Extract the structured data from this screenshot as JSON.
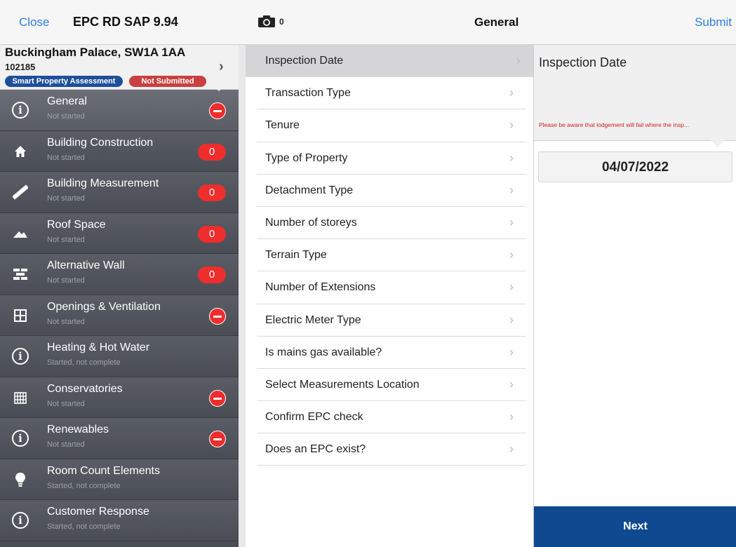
{
  "topbar": {
    "close_label": "Close",
    "app_title": "EPC RD SAP 9.94",
    "camera_count": "0",
    "section_title": "General",
    "submit_label": "Submit"
  },
  "property": {
    "name": "Buckingham Palace, SW1A 1AA",
    "id": "102185",
    "badge_assessment": "Smart Property Assessment",
    "badge_status": "Not Submitted"
  },
  "sidebar": {
    "items": [
      {
        "label": "General",
        "status": "Not started",
        "icon": "info-icon",
        "indicator": "minus"
      },
      {
        "label": "Building Construction",
        "status": "Not started",
        "icon": "house-icon",
        "indicator": "0"
      },
      {
        "label": "Building Measurement",
        "status": "Not started",
        "icon": "ruler-icon",
        "indicator": "0"
      },
      {
        "label": "Roof Space",
        "status": "Not started",
        "icon": "roof-icon",
        "indicator": "0"
      },
      {
        "label": "Alternative Wall",
        "status": "Not started",
        "icon": "brick-wall-icon",
        "indicator": "0"
      },
      {
        "label": "Openings & Ventilation",
        "status": "Not started",
        "icon": "window-icon",
        "indicator": "minus"
      },
      {
        "label": "Heating & Hot Water",
        "status": "Started, not complete",
        "icon": "info-icon",
        "indicator": ""
      },
      {
        "label": "Conservatories",
        "status": "Not started",
        "icon": "conservatory-icon",
        "indicator": "minus"
      },
      {
        "label": "Renewables",
        "status": "Not started",
        "icon": "info-icon",
        "indicator": "minus"
      },
      {
        "label": "Room Count Elements",
        "status": "Started, not complete",
        "icon": "lightbulb-icon",
        "indicator": ""
      },
      {
        "label": "Customer Response",
        "status": "Started, not complete",
        "icon": "info-icon",
        "indicator": ""
      }
    ]
  },
  "questions": [
    "Inspection Date",
    "Transaction Type",
    "Tenure",
    "Type of Property",
    "Detachment Type",
    "Number of storeys",
    "Terrain Type",
    "Number of Extensions",
    "Electric Meter Type",
    "Is mains gas available?",
    "Select Measurements Location",
    "Confirm EPC check",
    "Does an EPC exist?"
  ],
  "detail": {
    "title": "Inspection Date",
    "warning": "Please be aware that lodgement will fail where the insp...",
    "date_value": "04/07/2022",
    "next_label": "Next"
  },
  "colors": {
    "accent_blue": "#2f7de1",
    "next_button": "#0f4a91",
    "alert_red": "#ee2d2d",
    "sidebar_bg": "#4a4d55"
  }
}
